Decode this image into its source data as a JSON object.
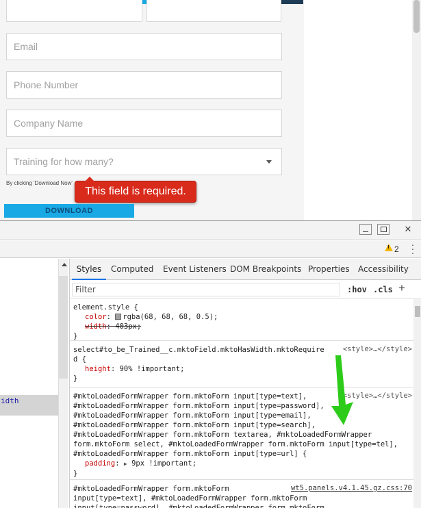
{
  "form": {
    "email_placeholder": "Email",
    "phone_placeholder": "Phone Number",
    "company_placeholder": "Company Name",
    "training_select": "Training for how many?",
    "consent_text": "By clicking 'Download Now'",
    "error_tooltip": "This field is required.",
    "download_button": "DOWNLOAD"
  },
  "devtools": {
    "warning_count": "2",
    "elements_snippet": "idth",
    "tabs": [
      "Styles",
      "Computed",
      "Event Listeners",
      "DOM Breakpoints",
      "Properties",
      "Accessibility"
    ],
    "filter_placeholder": "Filter",
    "hov_label": ":hov",
    "cls_label": ".cls",
    "plus_label": "+",
    "rules": [
      {
        "selector": "element.style {",
        "props": [
          {
            "name": "color",
            "value": "rgba(68, 68, 68, 0.5);"
          },
          {
            "name": "width",
            "value": "403px;"
          }
        ],
        "close": "}"
      },
      {
        "selector": "select#to_be_Trained__c.mktoField.mktoHasWidth.mktoRequire\nd {",
        "source": "<style>…</style>",
        "props": [
          {
            "name": "height",
            "value": "90% !important;"
          }
        ],
        "close": "}"
      },
      {
        "selector": "#mktoLoadedFormWrapper form.mktoForm input[type=text],\n#mktoLoadedFormWrapper form.mktoForm input[type=password],\n#mktoLoadedFormWrapper form.mktoForm input[type=email],\n#mktoLoadedFormWrapper form.mktoForm input[type=search],\n#mktoLoadedFormWrapper form.mktoForm textarea, #mktoLoadedFormWrapper\nform.mktoForm select, #mktoLoadedFormWrapper form.mktoForm input[type=tel],\n#mktoLoadedFormWrapper form.mktoForm input[type=url] {",
        "source": "<style>…</style>",
        "props": [
          {
            "name": "padding",
            "value": "9px !important;"
          }
        ],
        "close": "}"
      },
      {
        "selector": "#mktoLoadedFormWrapper form.mktoForm\ninput[type=text], #mktoLoadedFormWrapper form.mktoForm\ninput[type=password], #mktoLoadedFormWrapper form.mktoForm",
        "source": "wt5.panels.v4.1.45.gz.css:70"
      }
    ]
  },
  "colors": {
    "accent_blue": "#19a9e5",
    "dark_navy": "#1e3c55",
    "error_red": "#d92b1c",
    "annotation_green": "#2ecc1a"
  }
}
